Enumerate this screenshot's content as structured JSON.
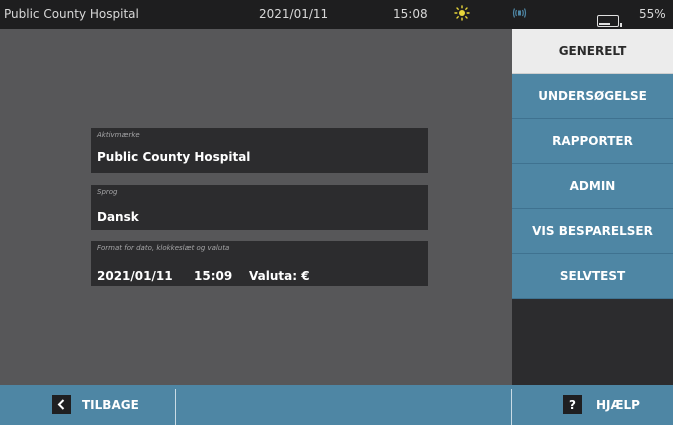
{
  "status": {
    "facility": "Public County Hospital",
    "date": "2021/01/11",
    "time": "15:08",
    "battery_percent": "55%",
    "brightness_icon": "brightness-icon",
    "volume_icon": "volume-icon",
    "battery_icon": "battery-icon"
  },
  "fields": [
    {
      "label": "Aktivmærke",
      "value": "Public County Hospital"
    },
    {
      "label": "Sprog",
      "value": "Dansk"
    },
    {
      "label": "Format for dato, klokkeslæt og valuta",
      "date": "2021/01/11",
      "time": "15:09",
      "currency": "Valuta: €"
    }
  ],
  "menu": {
    "items": [
      {
        "label": "GENERELT",
        "active": true
      },
      {
        "label": "UNDERSØGELSE"
      },
      {
        "label": "RAPPORTER"
      },
      {
        "label": "ADMIN"
      },
      {
        "label": "VIS BESPARELSER"
      },
      {
        "label": "SELVTEST"
      }
    ]
  },
  "bottom": {
    "back_icon": "chevron-left-icon",
    "back_label": "TILBAGE",
    "help_icon_glyph": "?",
    "help_label": "HJÆLP"
  },
  "colors": {
    "accent_blue": "#4e86a4",
    "status_bar": "#1e1e1f",
    "brightness_icon": "#e8d63a",
    "volume_icon": "#4e86a4"
  }
}
